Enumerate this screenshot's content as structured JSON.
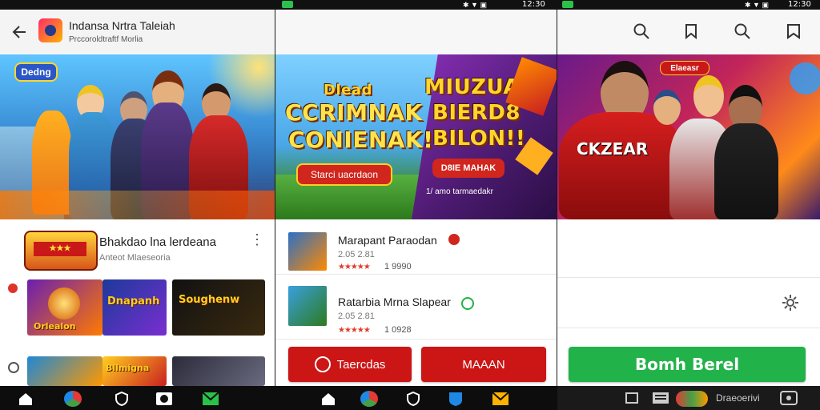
{
  "status": {
    "clock_center": "12:30",
    "clock_right": "12:30"
  },
  "panel1": {
    "title": "Indansa Nrtra Taleiah",
    "subtitle": "Prccoroldtraftf Morlia",
    "banner_badge": "Dedng",
    "app_row": {
      "title": "Bhakdao lna lerdeana",
      "subtitle": "Anteot Mlaeseoria"
    },
    "tiles": [
      "Orlealon",
      "Dnapanh",
      "Soughenw",
      "Bllmigna"
    ]
  },
  "panel2": {
    "banner_left_line1": "Dlead",
    "banner_left_line2": "CCRIMNAK",
    "banner_left_line3": "CONIENAK!",
    "banner_right_line1": "MIUZUAA",
    "banner_right_line2": "BIERD8",
    "banner_right_line3": "BILON!!",
    "cta_left": "Starci uacrdaon",
    "cta_right": "D8IE MAHAK",
    "footnote": "1/ amo tarmaedakr",
    "items": [
      {
        "title": "Marapant Paraodan",
        "meta": "2.05 2.81",
        "stars": "★★★★★",
        "count": "1 9990"
      },
      {
        "title": "Ratarbia Mrna Slapear",
        "meta": "2.05 2.81",
        "stars": "★★★★★",
        "count": "1 0928"
      }
    ],
    "btn_left": "Taercdas",
    "btn_right": "MAAAN"
  },
  "panel3": {
    "banner_tag": "Elaeasr",
    "jersey_text": "CKZEAR",
    "install_label": "Bomh Berel",
    "nav_text": "Draeoerivi"
  },
  "colors": {
    "accent_red": "#cc1515",
    "accent_green": "#22b24a",
    "banner_purple": "#4a1a6e"
  }
}
